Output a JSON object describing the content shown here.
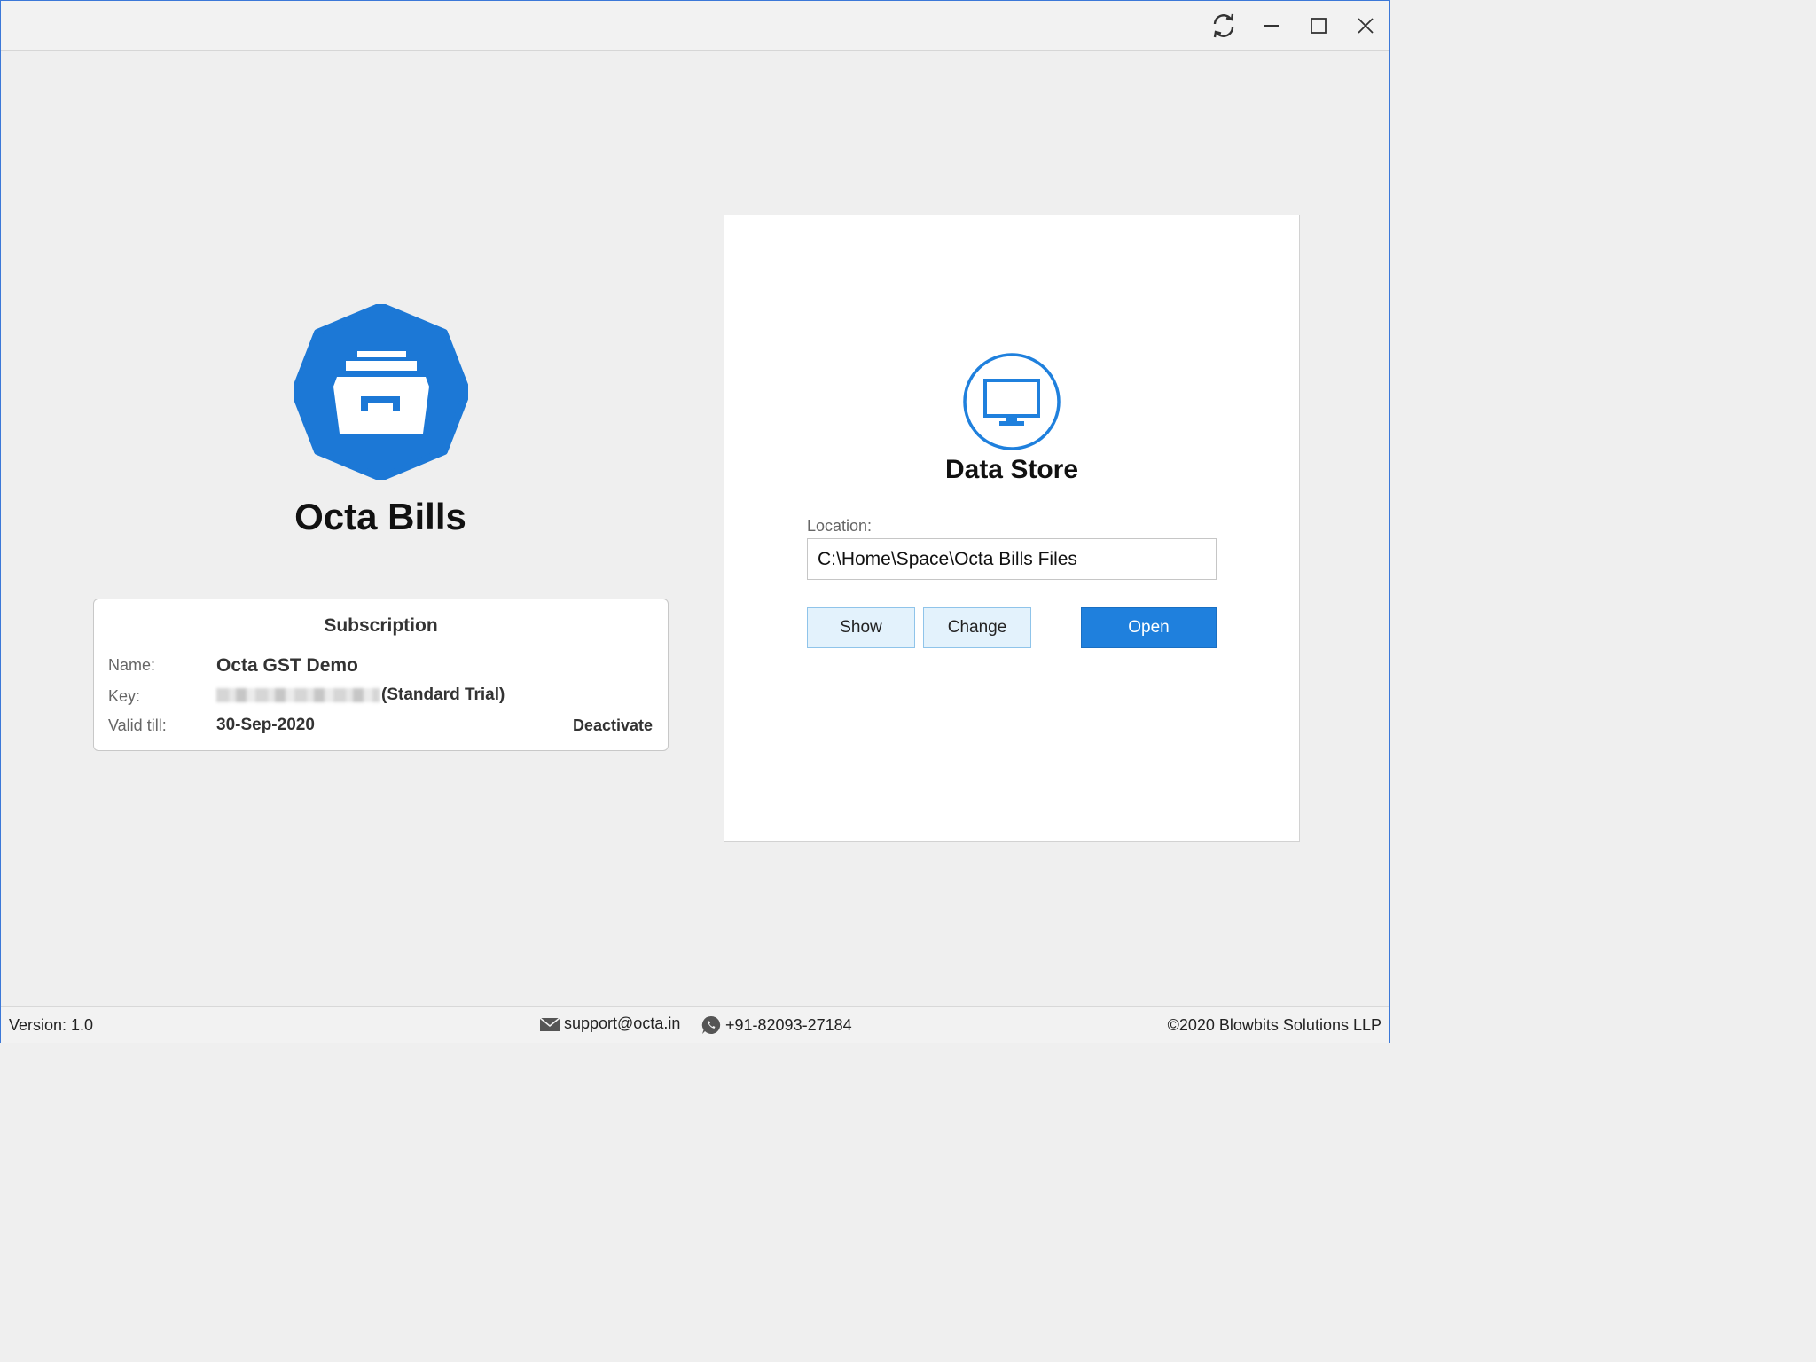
{
  "window": {
    "controls": {
      "refresh_icon": "refresh-icon",
      "minimize_icon": "minimize-icon",
      "maximize_icon": "maximize-icon",
      "close_icon": "close-icon"
    }
  },
  "app": {
    "name": "Octa Bills",
    "logo_icon": "archive-box-icon",
    "brand_color": "#1c78d6"
  },
  "subscription": {
    "title": "Subscription",
    "name_label": "Name:",
    "name_value": "Octa GST Demo",
    "key_label": "Key:",
    "key_suffix": "(Standard Trial)",
    "valid_label": "Valid till:",
    "valid_value": "30-Sep-2020",
    "deactivate_label": "Deactivate"
  },
  "data_store": {
    "icon": "monitor-icon",
    "title": "Data Store",
    "location_label": "Location:",
    "location_value": "C:\\Home\\Space\\Octa Bills Files",
    "show_label": "Show",
    "change_label": "Change",
    "open_label": "Open",
    "primary_color": "#1f80dd"
  },
  "status_bar": {
    "version": "Version: 1.0",
    "email": "support@octa.in",
    "phone": "+91-82093-27184",
    "copyright": "©2020 Blowbits Solutions LLP"
  }
}
